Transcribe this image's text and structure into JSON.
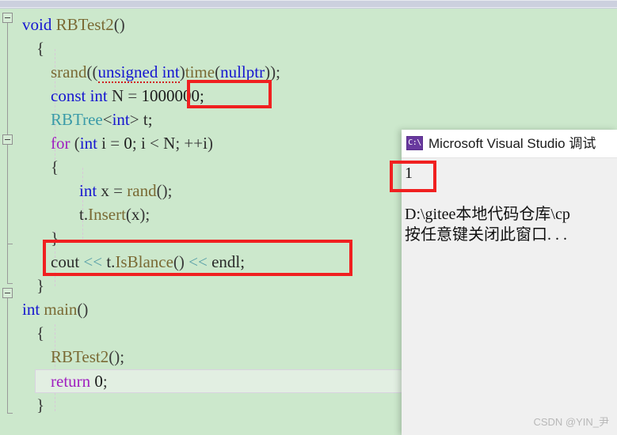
{
  "editor": {
    "background_color": "#cce8cc",
    "current_line_label": "return 0;",
    "lines": [
      {
        "indent": 0,
        "text": "void RBTest2()"
      },
      {
        "indent": 1,
        "text": "{"
      },
      {
        "indent": 2,
        "text": "srand((unsigned int)time(nullptr));"
      },
      {
        "indent": 2,
        "text": "const int N = 1000000;"
      },
      {
        "indent": 2,
        "text": "RBTree<int> t;"
      },
      {
        "indent": 2,
        "text": "for (int i = 0; i < N; ++i)"
      },
      {
        "indent": 2,
        "text": "{"
      },
      {
        "indent": 3,
        "text": "int x = rand();"
      },
      {
        "indent": 3,
        "text": "t.Insert(x);"
      },
      {
        "indent": 2,
        "text": "}"
      },
      {
        "indent": 2,
        "text": "cout << t.IsBlance() << endl;"
      },
      {
        "indent": 1,
        "text": "}"
      },
      {
        "indent": 0,
        "text": "int main()"
      },
      {
        "indent": 1,
        "text": "{"
      },
      {
        "indent": 2,
        "text": "RBTest2();"
      },
      {
        "indent": 2,
        "text": "return 0;"
      },
      {
        "indent": 1,
        "text": "}"
      }
    ],
    "tokens": {
      "void": "void",
      "rbtest2": "RBTest2",
      "srand": "srand",
      "unsigned_int": "unsigned int",
      "time": "time",
      "nullptr": "nullptr",
      "const": "const",
      "int": "int",
      "n_name": "N",
      "n_value": "1000000",
      "rbtree": "RBTree",
      "t_name": "t",
      "for": "for",
      "i_name": "i",
      "zero": "0",
      "x_name": "x",
      "rand": "rand",
      "insert": "Insert",
      "cout": "cout",
      "stream_op": "<<",
      "isblance": "IsBlance",
      "endl": "endl",
      "main": "main",
      "return": "return"
    }
  },
  "annotations": {
    "box_n_value": "1000000;",
    "box_cout_line": "cout << t.IsBlance() << endl;",
    "box_console_output": "1",
    "color": "#f02020"
  },
  "console": {
    "icon_name": "cmd-console-icon",
    "icon_glyph": "C:\\",
    "title": "Microsoft Visual Studio 调试",
    "output_value": "1",
    "path_line": "D:\\gitee本地代码仓库\\cp",
    "prompt_line": "按任意键关闭此窗口. . ."
  },
  "scrollbar": {
    "orientation": "horizontal",
    "name": "horizontal-scrollbar"
  },
  "watermark": {
    "text": "CSDN @YIN_尹"
  }
}
